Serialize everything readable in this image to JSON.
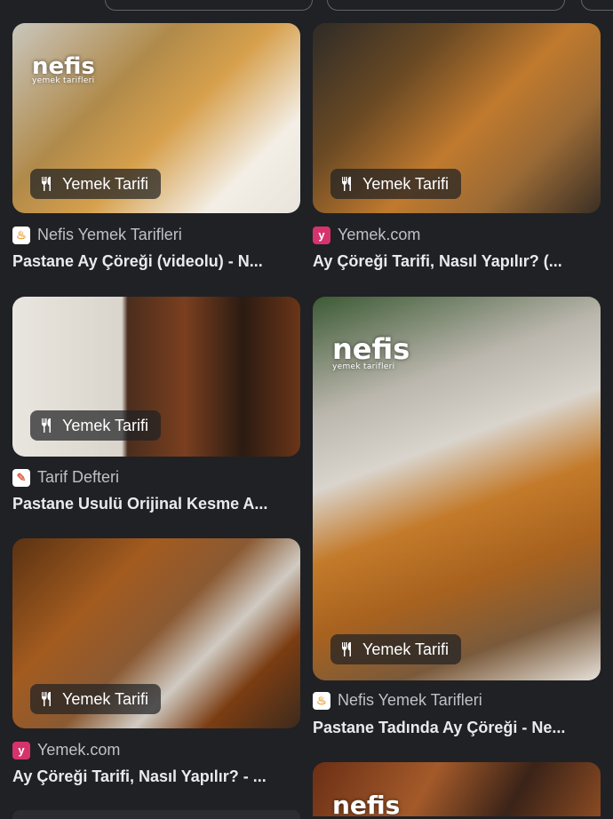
{
  "badge_label": "Yemek Tarifi",
  "watermark": {
    "brand": "nefis",
    "sub": "yemek tarifleri"
  },
  "results": [
    {
      "source": "Nefis Yemek Tarifleri",
      "title": "Pastane Ay Çöreği (videolu) - N..."
    },
    {
      "source": "Yemek.com",
      "title": "Ay Çöreği Tarifi, Nasıl Yapılır? (..."
    },
    {
      "source": "Tarif Defteri",
      "title": "Pastane Usulü Orijinal Kesme A..."
    },
    {
      "source": "Nefis Yemek Tarifleri",
      "title": "Pastane Tadında Ay Çöreği - Ne..."
    },
    {
      "source": "Yemek.com",
      "title": "Ay Çöreği Tarifi, Nasıl Yapılır? - ..."
    }
  ],
  "colors": {
    "background": "#202124",
    "text": "#e8eaed",
    "source_text": "#bdc1c6"
  },
  "icons": {
    "badge": "fork-knife-icon"
  }
}
